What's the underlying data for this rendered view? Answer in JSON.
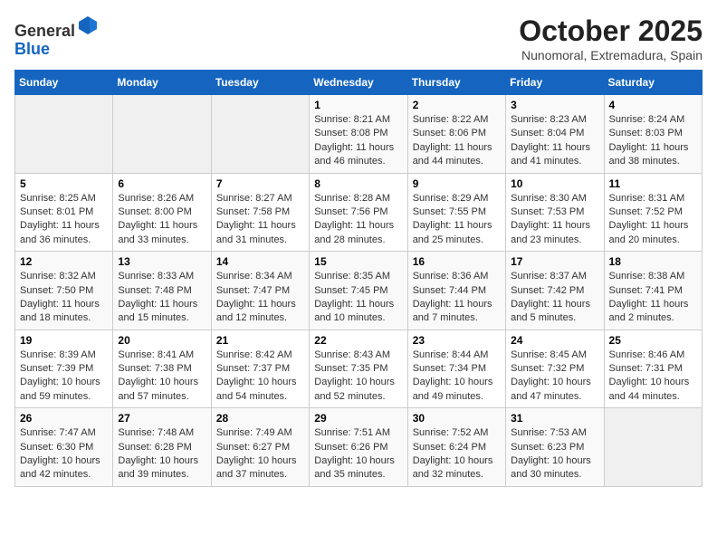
{
  "header": {
    "logo_general": "General",
    "logo_blue": "Blue",
    "month_title": "October 2025",
    "location": "Nunomoral, Extremadura, Spain"
  },
  "days_of_week": [
    "Sunday",
    "Monday",
    "Tuesday",
    "Wednesday",
    "Thursday",
    "Friday",
    "Saturday"
  ],
  "weeks": [
    [
      {
        "day": "",
        "info": ""
      },
      {
        "day": "",
        "info": ""
      },
      {
        "day": "",
        "info": ""
      },
      {
        "day": "1",
        "info": "Sunrise: 8:21 AM\nSunset: 8:08 PM\nDaylight: 11 hours and 46 minutes."
      },
      {
        "day": "2",
        "info": "Sunrise: 8:22 AM\nSunset: 8:06 PM\nDaylight: 11 hours and 44 minutes."
      },
      {
        "day": "3",
        "info": "Sunrise: 8:23 AM\nSunset: 8:04 PM\nDaylight: 11 hours and 41 minutes."
      },
      {
        "day": "4",
        "info": "Sunrise: 8:24 AM\nSunset: 8:03 PM\nDaylight: 11 hours and 38 minutes."
      }
    ],
    [
      {
        "day": "5",
        "info": "Sunrise: 8:25 AM\nSunset: 8:01 PM\nDaylight: 11 hours and 36 minutes."
      },
      {
        "day": "6",
        "info": "Sunrise: 8:26 AM\nSunset: 8:00 PM\nDaylight: 11 hours and 33 minutes."
      },
      {
        "day": "7",
        "info": "Sunrise: 8:27 AM\nSunset: 7:58 PM\nDaylight: 11 hours and 31 minutes."
      },
      {
        "day": "8",
        "info": "Sunrise: 8:28 AM\nSunset: 7:56 PM\nDaylight: 11 hours and 28 minutes."
      },
      {
        "day": "9",
        "info": "Sunrise: 8:29 AM\nSunset: 7:55 PM\nDaylight: 11 hours and 25 minutes."
      },
      {
        "day": "10",
        "info": "Sunrise: 8:30 AM\nSunset: 7:53 PM\nDaylight: 11 hours and 23 minutes."
      },
      {
        "day": "11",
        "info": "Sunrise: 8:31 AM\nSunset: 7:52 PM\nDaylight: 11 hours and 20 minutes."
      }
    ],
    [
      {
        "day": "12",
        "info": "Sunrise: 8:32 AM\nSunset: 7:50 PM\nDaylight: 11 hours and 18 minutes."
      },
      {
        "day": "13",
        "info": "Sunrise: 8:33 AM\nSunset: 7:48 PM\nDaylight: 11 hours and 15 minutes."
      },
      {
        "day": "14",
        "info": "Sunrise: 8:34 AM\nSunset: 7:47 PM\nDaylight: 11 hours and 12 minutes."
      },
      {
        "day": "15",
        "info": "Sunrise: 8:35 AM\nSunset: 7:45 PM\nDaylight: 11 hours and 10 minutes."
      },
      {
        "day": "16",
        "info": "Sunrise: 8:36 AM\nSunset: 7:44 PM\nDaylight: 11 hours and 7 minutes."
      },
      {
        "day": "17",
        "info": "Sunrise: 8:37 AM\nSunset: 7:42 PM\nDaylight: 11 hours and 5 minutes."
      },
      {
        "day": "18",
        "info": "Sunrise: 8:38 AM\nSunset: 7:41 PM\nDaylight: 11 hours and 2 minutes."
      }
    ],
    [
      {
        "day": "19",
        "info": "Sunrise: 8:39 AM\nSunset: 7:39 PM\nDaylight: 10 hours and 59 minutes."
      },
      {
        "day": "20",
        "info": "Sunrise: 8:41 AM\nSunset: 7:38 PM\nDaylight: 10 hours and 57 minutes."
      },
      {
        "day": "21",
        "info": "Sunrise: 8:42 AM\nSunset: 7:37 PM\nDaylight: 10 hours and 54 minutes."
      },
      {
        "day": "22",
        "info": "Sunrise: 8:43 AM\nSunset: 7:35 PM\nDaylight: 10 hours and 52 minutes."
      },
      {
        "day": "23",
        "info": "Sunrise: 8:44 AM\nSunset: 7:34 PM\nDaylight: 10 hours and 49 minutes."
      },
      {
        "day": "24",
        "info": "Sunrise: 8:45 AM\nSunset: 7:32 PM\nDaylight: 10 hours and 47 minutes."
      },
      {
        "day": "25",
        "info": "Sunrise: 8:46 AM\nSunset: 7:31 PM\nDaylight: 10 hours and 44 minutes."
      }
    ],
    [
      {
        "day": "26",
        "info": "Sunrise: 7:47 AM\nSunset: 6:30 PM\nDaylight: 10 hours and 42 minutes."
      },
      {
        "day": "27",
        "info": "Sunrise: 7:48 AM\nSunset: 6:28 PM\nDaylight: 10 hours and 39 minutes."
      },
      {
        "day": "28",
        "info": "Sunrise: 7:49 AM\nSunset: 6:27 PM\nDaylight: 10 hours and 37 minutes."
      },
      {
        "day": "29",
        "info": "Sunrise: 7:51 AM\nSunset: 6:26 PM\nDaylight: 10 hours and 35 minutes."
      },
      {
        "day": "30",
        "info": "Sunrise: 7:52 AM\nSunset: 6:24 PM\nDaylight: 10 hours and 32 minutes."
      },
      {
        "day": "31",
        "info": "Sunrise: 7:53 AM\nSunset: 6:23 PM\nDaylight: 10 hours and 30 minutes."
      },
      {
        "day": "",
        "info": ""
      }
    ]
  ]
}
